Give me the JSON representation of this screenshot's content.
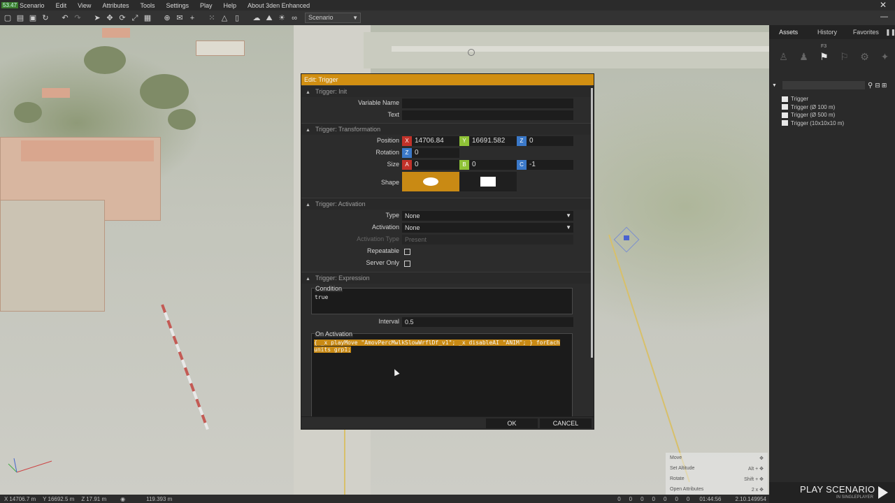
{
  "menubar": {
    "fps": "53.47",
    "items": [
      "Scenario",
      "Edit",
      "View",
      "Attributes",
      "Tools",
      "Settings",
      "Play",
      "Help",
      "About 3den Enhanced"
    ]
  },
  "toolbar": {
    "scenario_select": "Scenario"
  },
  "right_panel": {
    "tabs": [
      "Assets",
      "History",
      "Favorites"
    ],
    "active_tab": "Assets",
    "active_category_hotkey": "F3",
    "assets": [
      "Trigger",
      "Trigger (Ø 100 m)",
      "Trigger (Ø 500 m)",
      "Trigger (10x10x10 m)"
    ]
  },
  "hints": [
    {
      "action": "Move",
      "key": ""
    },
    {
      "action": "Set Altitude",
      "key": "Alt +"
    },
    {
      "action": "Rotate",
      "key": "Shift +"
    },
    {
      "action": "Open Attributes",
      "key": "2 x"
    }
  ],
  "play": {
    "label": "PLAY SCENARIO",
    "sub": "IN SINGLEPLAYER"
  },
  "statusbar": {
    "x": "14706.7 m",
    "y": "16692.5 m",
    "z": "17.91 m",
    "distance": "119.393 m",
    "time": "01:44:56",
    "version": "2.10.149954",
    "counts": [
      "0",
      "0",
      "0",
      "0",
      "0",
      "0",
      "0"
    ]
  },
  "dialog": {
    "title": "Edit: Trigger",
    "sections": {
      "init": "Trigger: Init",
      "transformation": "Trigger: Transformation",
      "activation": "Trigger: Activation",
      "expression": "Trigger: Expression"
    },
    "labels": {
      "variable_name": "Variable Name",
      "text": "Text",
      "position": "Position",
      "rotation": "Rotation",
      "size": "Size",
      "shape": "Shape",
      "type": "Type",
      "activation": "Activation",
      "activation_type": "Activation Type",
      "repeatable": "Repeatable",
      "server_only": "Server Only",
      "condition": "Condition",
      "interval": "Interval",
      "on_activation": "On Activation"
    },
    "values": {
      "variable_name": "",
      "text": "",
      "pos_x": "14706.84",
      "pos_y": "16691.582",
      "pos_z": "0",
      "rot_z": "0",
      "size_a": "0",
      "size_b": "0",
      "size_c": "-1",
      "shape_selected": "ellipse",
      "type": "None",
      "activation": "None",
      "activation_type": "Present",
      "repeatable": false,
      "server_only": false,
      "condition": "true",
      "interval": "0.5",
      "on_activation_line1": "{ _x playMove \"AmovPercMwlkSlowWrflDf_v1\"; _x disableAI \"ANIM\"; } forEach",
      "on_activation_line2": "units grp1;"
    },
    "axes": {
      "x": "X",
      "y": "Y",
      "z": "Z",
      "a": "A",
      "b": "B",
      "c": "C"
    },
    "buttons": {
      "ok": "OK",
      "cancel": "CANCEL"
    }
  },
  "colors": {
    "accent": "#d18f12",
    "axis_x": "#c2322a",
    "axis_y": "#8fc237",
    "axis_z": "#3b79c9"
  }
}
